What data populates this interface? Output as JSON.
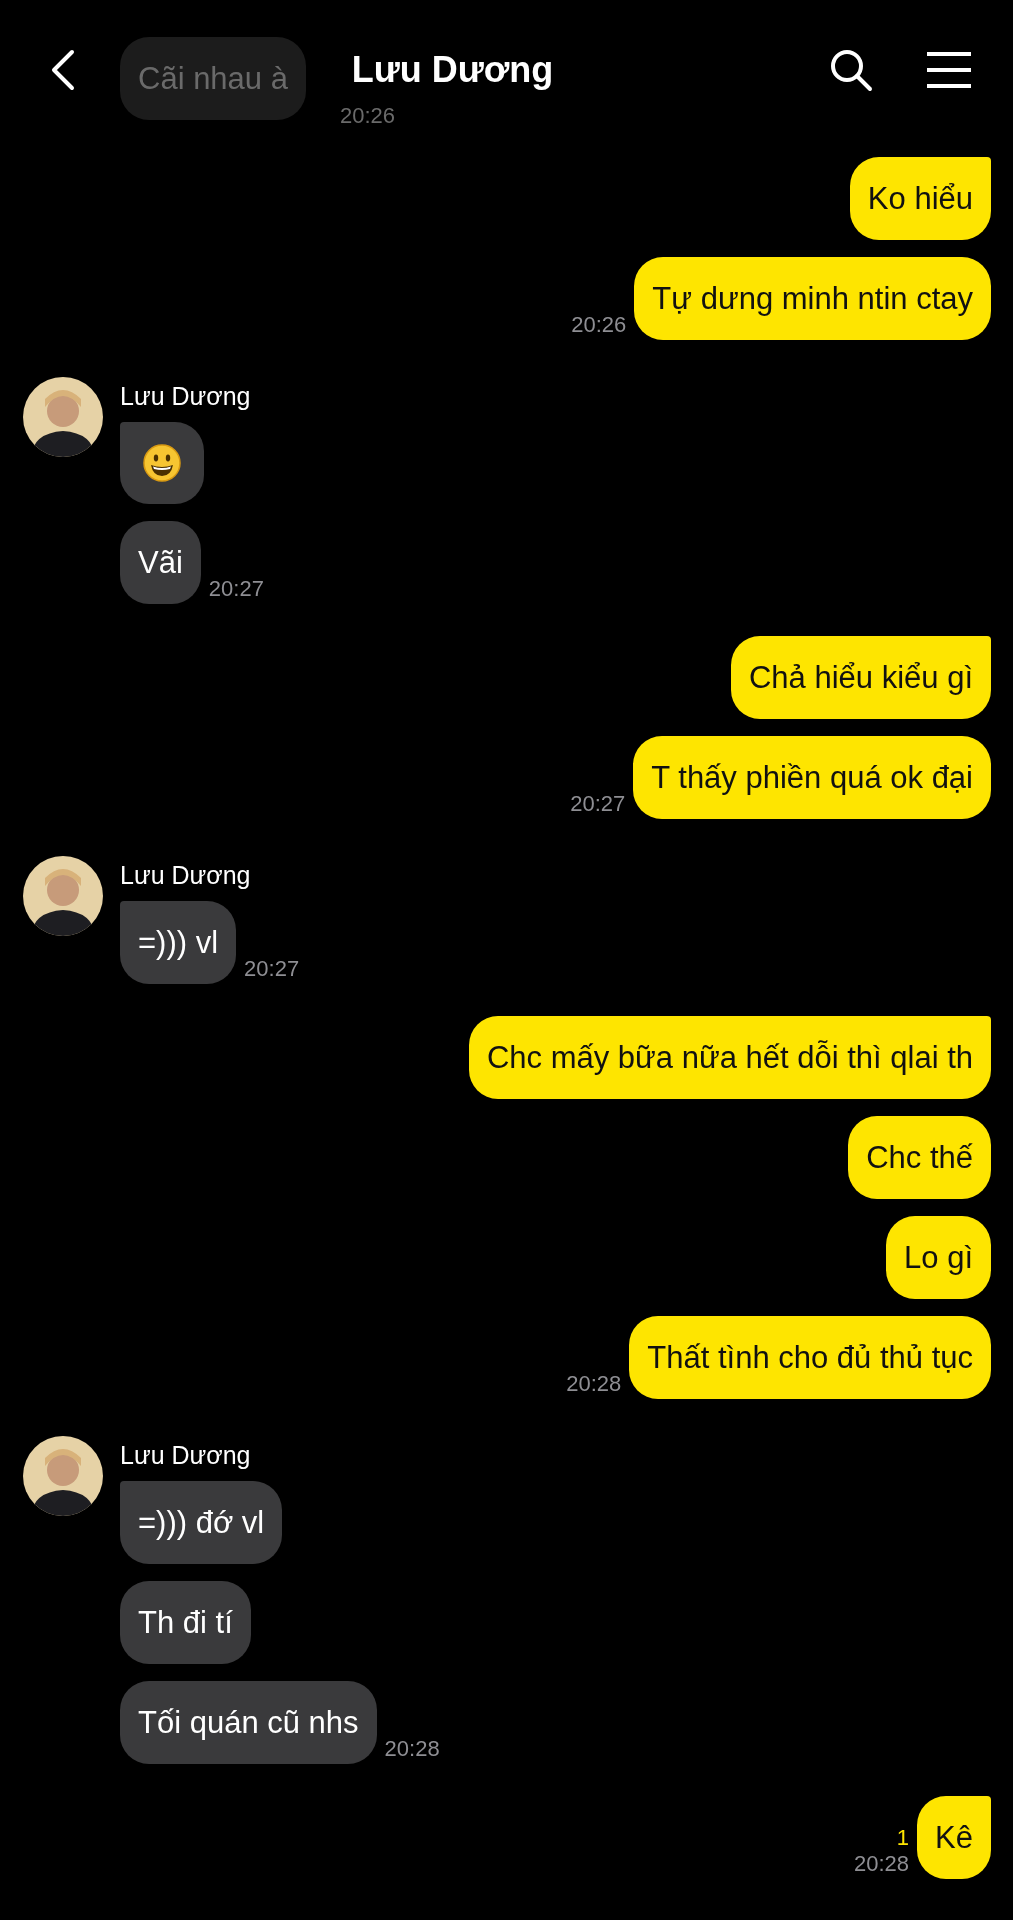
{
  "header": {
    "title": "Lưu Dương"
  },
  "faded_message": {
    "text": "Cãi nhau à",
    "time": "20:26"
  },
  "groups": [
    {
      "kind": "outgoing",
      "messages": [
        {
          "kind": "text",
          "text": "Ko hiểu"
        },
        {
          "kind": "text",
          "text": "Tự dưng minh ntin ctay"
        }
      ],
      "time": "20:26"
    },
    {
      "kind": "incoming",
      "name": "Lưu Dương",
      "messages": [
        {
          "kind": "emoji"
        },
        {
          "kind": "text",
          "text": "Vãi"
        }
      ],
      "time": "20:27"
    },
    {
      "kind": "outgoing",
      "messages": [
        {
          "kind": "text",
          "text": "Chả hiểu kiểu gì"
        },
        {
          "kind": "text",
          "text": "T thấy phiền quá ok đại"
        }
      ],
      "time": "20:27"
    },
    {
      "kind": "incoming",
      "name": "Lưu Dương",
      "messages": [
        {
          "kind": "text",
          "text": "=))) vl"
        }
      ],
      "time": "20:27"
    },
    {
      "kind": "outgoing",
      "messages": [
        {
          "kind": "text",
          "text": "Chc mấy bữa nữa hết dỗi thì qlai th"
        },
        {
          "kind": "text",
          "text": "Chc thế"
        },
        {
          "kind": "text",
          "text": "Lo gì"
        },
        {
          "kind": "text",
          "text": "Thất tình cho đủ thủ tục"
        }
      ],
      "time": "20:28"
    },
    {
      "kind": "incoming",
      "name": "Lưu Dương",
      "messages": [
        {
          "kind": "text",
          "text": "=))) đớ vl"
        },
        {
          "kind": "text",
          "text": "Th đi tí"
        },
        {
          "kind": "text",
          "text": "Tối quán cũ nhs"
        }
      ],
      "time": "20:28"
    },
    {
      "kind": "outgoing",
      "messages": [
        {
          "kind": "text",
          "text": "Kê"
        }
      ],
      "time": "20:28",
      "unread": "1"
    }
  ]
}
